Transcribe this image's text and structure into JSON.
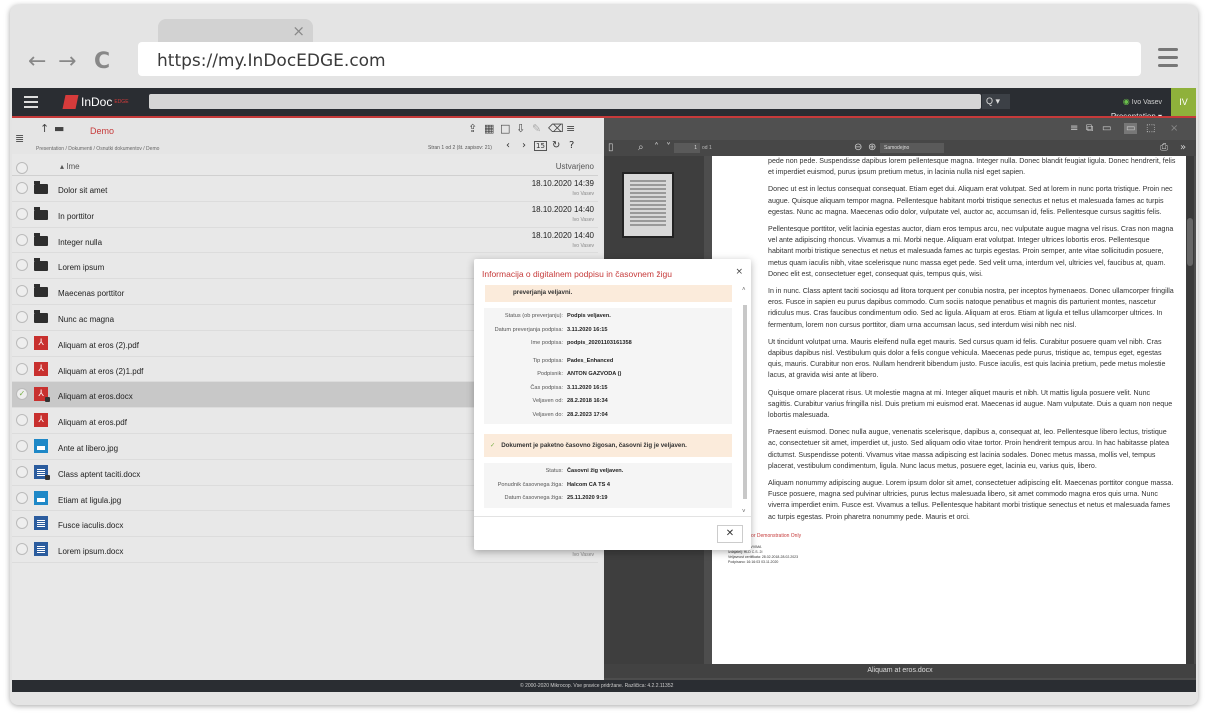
{
  "browser": {
    "tab_close": "×",
    "url": "https://my.InDocEDGE.com",
    "back": "←",
    "forward": "→",
    "reload": "C"
  },
  "app": {
    "logo_text": "InDoc",
    "logo_sup": "EDGE",
    "search_dropdown": "Q ▾",
    "user_status": "◉",
    "user_name": "Ivo Vasev",
    "user_org": "Presentation ▾",
    "avatar": "IV",
    "colors": {
      "accent": "#c63a3a",
      "topbar": "#2a2d32",
      "avatar": "#8fb13b"
    }
  },
  "left_panel": {
    "folder_title": "Demo",
    "breadcrumb": "Presentation  /  Dokumenti  /  Osnutki dokumentov  /  Demo",
    "page_info": "Stran 1 od 2 (št. zapisov: 21)",
    "page_number": "15",
    "col_name": "▴ Ime",
    "col_date": "Ustvarjeno",
    "rows": [
      {
        "name": "Dolor sit amet",
        "type": "folder",
        "date": "18.10.2020 14:39",
        "user": "Ivo Vasev"
      },
      {
        "name": "In porttitor",
        "type": "folder",
        "date": "18.10.2020 14:40",
        "user": "Ivo Vasev"
      },
      {
        "name": "Integer nulla",
        "type": "folder",
        "date": "18.10.2020 14:40",
        "user": "Ivo Vasev"
      },
      {
        "name": "Lorem ipsum",
        "type": "folder",
        "date": "",
        "user": ""
      },
      {
        "name": "Maecenas porttitor",
        "type": "folder",
        "date": "",
        "user": ""
      },
      {
        "name": "Nunc ac magna",
        "type": "folder",
        "date": "",
        "user": ""
      },
      {
        "name": "Aliquam at eros (2).pdf",
        "type": "pdf",
        "date": "",
        "user": ""
      },
      {
        "name": "Aliquam at eros (2)1.pdf",
        "type": "pdf",
        "date": "",
        "user": ""
      },
      {
        "name": "Aliquam at eros.docx",
        "type": "pdf",
        "date": "",
        "user": "",
        "selected": true,
        "locked": true
      },
      {
        "name": "Aliquam at eros.pdf",
        "type": "pdf",
        "date": "",
        "user": ""
      },
      {
        "name": "Ante at libero.jpg",
        "type": "jpg",
        "date": "",
        "user": ""
      },
      {
        "name": "Class aptent taciti.docx",
        "type": "doc",
        "date": "",
        "user": "",
        "locked": true
      },
      {
        "name": "Etiam at ligula.jpg",
        "type": "jpg",
        "date": "",
        "user": ""
      },
      {
        "name": "Fusce iaculis.docx",
        "type": "doc",
        "date": "",
        "user": ""
      },
      {
        "name": "Lorem ipsum.docx",
        "type": "doc",
        "date": "",
        "user": "Ivo Vasev"
      }
    ]
  },
  "viewer": {
    "zoom_label": "Samodejno",
    "page_current": "1",
    "page_of": "od 1",
    "doc_name": "Aliquam at eros.docx",
    "paragraphs": [
      "pede non pede. Suspendisse dapibus lorem pellentesque magna. Integer nulla. Donec blandit feugiat ligula. Donec hendrerit, felis et imperdiet euismod, purus ipsum pretium metus, in lacinia nulla nisl eget sapien.",
      "Donec ut est in lectus consequat consequat. Etiam eget dui. Aliquam erat volutpat. Sed at lorem in nunc porta tristique. Proin nec augue. Quisque aliquam tempor magna. Pellentesque habitant morbi tristique senectus et netus et malesuada fames ac turpis egestas. Nunc ac magna. Maecenas odio dolor, vulputate vel, auctor ac, accumsan id, felis. Pellentesque cursus sagittis felis.",
      "Pellentesque porttitor, velit lacinia egestas auctor, diam eros tempus arcu, nec vulputate augue magna vel risus. Cras non magna vel ante adipiscing rhoncus. Vivamus a mi. Morbi neque. Aliquam erat volutpat. Integer ultrices lobortis eros. Pellentesque habitant morbi tristique senectus et netus et malesuada fames ac turpis egestas. Proin semper, ante vitae sollicitudin posuere, metus quam iaculis nibh, vitae scelerisque nunc massa eget pede. Sed velit urna, interdum vel, ultricies vel, faucibus at, quam. Donec elit est, consectetuer eget, consequat quis, tempus quis, wisi.",
      "In in nunc. Class aptent taciti sociosqu ad litora torquent per conubia nostra, per inceptos hymenaeos. Donec ullamcorper fringilla eros. Fusce in sapien eu purus dapibus commodo. Cum sociis natoque penatibus et magnis dis parturient montes, nascetur ridiculus mus. Cras faucibus condimentum odio. Sed ac ligula. Aliquam at eros. Etiam at ligula et tellus ullamcorper ultrices. In fermentum, lorem non cursus porttitor, diam urna accumsan lacus, sed interdum wisi nibh nec nisl.",
      "Ut tincidunt volutpat urna. Mauris eleifend nulla eget mauris. Sed cursus quam id felis. Curabitur posuere quam vel nibh. Cras dapibus dapibus nisl. Vestibulum quis dolor a felis congue vehicula. Maecenas pede purus, tristique ac, tempus eget, egestas quis, mauris. Curabitur non eros. Nullam hendrerit bibendum justo. Fusce iaculis, est quis lacinia pretium, pede metus molestie lacus, at gravida wisi ante at libero.",
      "Quisque ornare placerat risus. Ut molestie magna at mi. Integer aliquet mauris et nibh. Ut mattis ligula posuere velit. Nunc sagittis. Curabitur varius fringilla nisl. Duis pretium mi euismod erat. Maecenas id augue. Nam vulputate. Duis a quam non neque lobortis malesuada.",
      "Praesent euismod. Donec nulla augue, venenatis scelerisque, dapibus a, consequat at, leo. Pellentesque libero lectus, tristique ac, consectetuer sit amet, imperdiet ut, justo. Sed aliquam odio vitae tortor. Proin hendrerit tempus arcu. In hac habitasse platea dictumst. Suspendisse potenti. Vivamus vitae massa adipiscing est lacinia sodales. Donec metus massa, mollis vel, tempus placerat, vestibulum condimentum, ligula. Nunc lacus metus, posuere eget, lacinia eu, varius quis, libero.",
      "Aliquam nonummy adipiscing augue. Lorem ipsum dolor sit amet, consectetuer adipiscing elit. Maecenas porttitor congue massa. Fusce posuere, magna sed pulvinar ultricies, purus lectus malesuada libero, sit amet commodo magna eros quis urna. Nunc viverra imperdiet enim. Fusce est. Vivamus a tellus. Pellentesque habitant morbi tristique senectus et netus et malesuada fames ac turpis egestas. Proin pharetra nonummy pede. Mauris et orci."
    ],
    "demo_only": "For Demonstration Only",
    "sig_lines": [
      "Podpisnik: ISAVVIMA",
      "Izdajatelj: HLD C.S. 2I",
      "Veljavnost certifikata: 28.02.2018-28.02.2023",
      "Podpisano: 16:16:03 03.11.2020"
    ]
  },
  "modal": {
    "title": "Informacija o digitalnem podpisu in časovnem žigu",
    "close": "×",
    "warn_text": "preverjanja veljavni.",
    "sig_group1": [
      {
        "k": "Status (ob preverjanju):",
        "v": "Podpis veljaven."
      },
      {
        "k": "Datum preverjanja podpisa:",
        "v": "3.11.2020 16:15"
      },
      {
        "k": "Ime podpisa:",
        "v": "podpis_20201103161358"
      }
    ],
    "sig_group2": [
      {
        "k": "Tip podpisa:",
        "v": "Pades_Enhanced"
      },
      {
        "k": "Podpisnik:",
        "v": "ANTON GAZVODA ()"
      },
      {
        "k": "Čas podpisa:",
        "v": "3.11.2020 16:15"
      },
      {
        "k": "Veljaven od:",
        "v": "28.2.2018 16:34"
      },
      {
        "k": "Veljaven do:",
        "v": "28.2.2023 17:04"
      }
    ],
    "ok_text": "Dokument je paketno časovno žigosan, časovni žig je veljaven.",
    "ts_group": [
      {
        "k": "Status:",
        "v": "Časovni žig veljaven."
      },
      {
        "k": "Ponudnik časovnega žiga:",
        "v": "Halcom CA TS 4"
      },
      {
        "k": "Datum časovnega žiga:",
        "v": "25.11.2020 9:19"
      }
    ],
    "close_button": "✕"
  },
  "footer": {
    "text": "© 2000-2020 Mikrocop. Vse pravice pridržane. Različica: 4.2.2.11352"
  }
}
